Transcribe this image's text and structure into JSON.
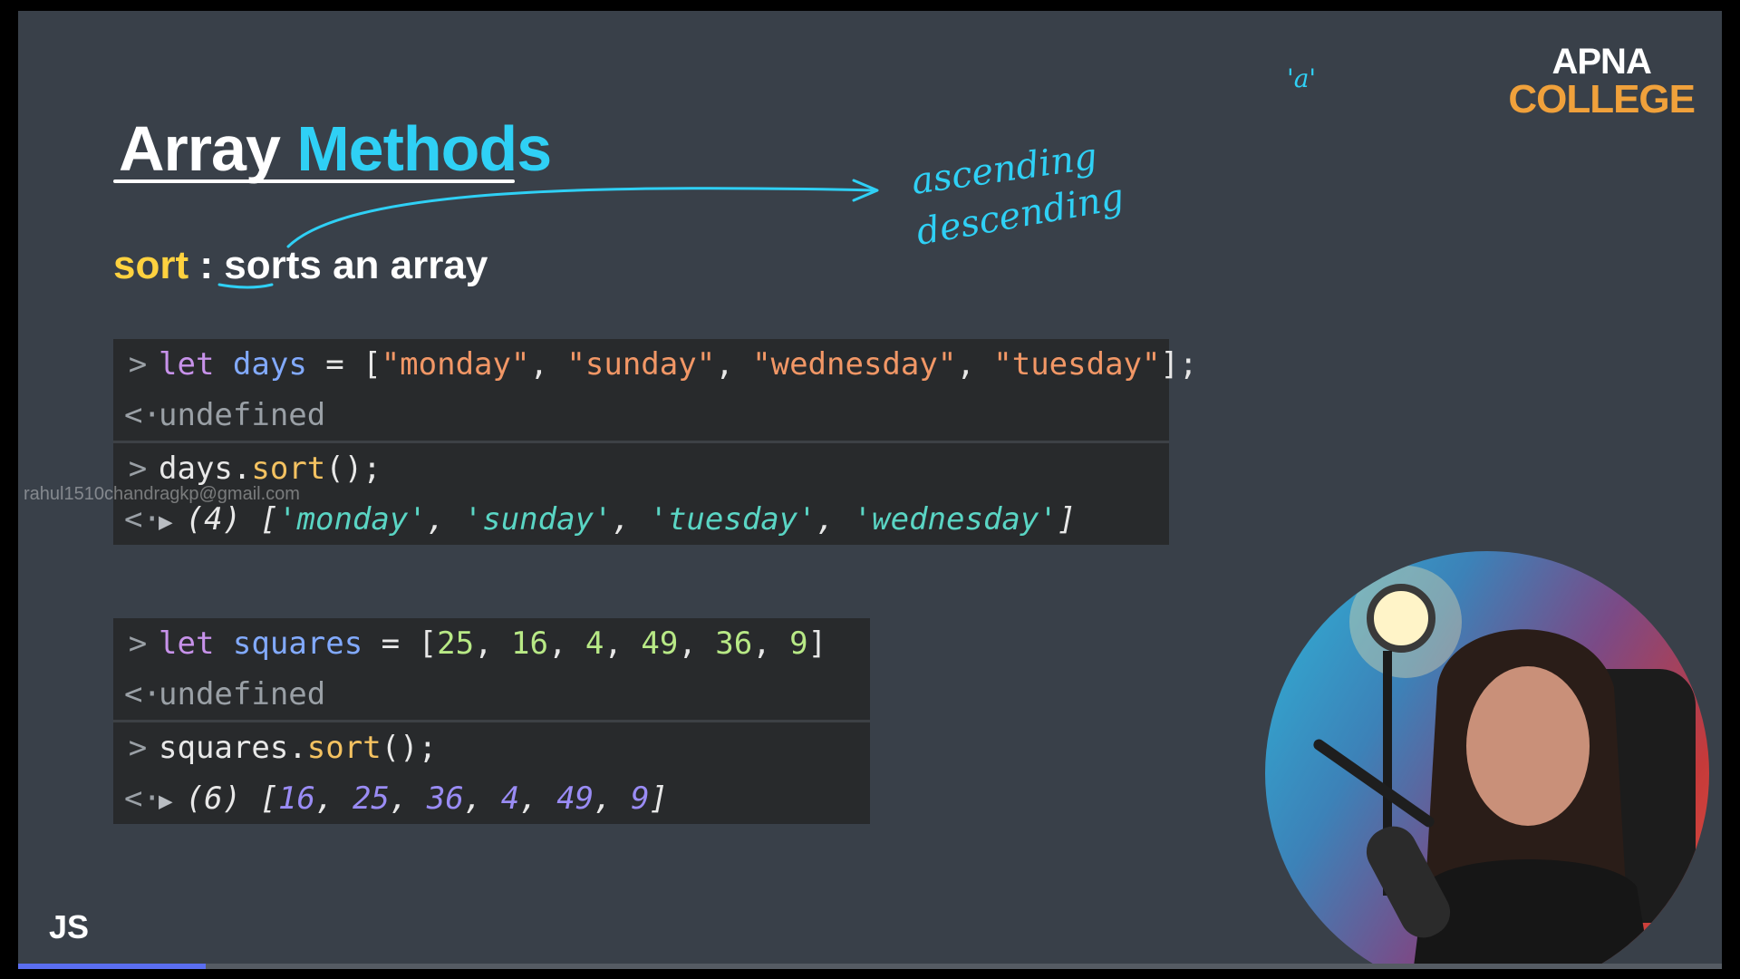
{
  "slide": {
    "title_part1": "Array",
    "title_part2": "Methods",
    "method_keyword": "sort",
    "method_separator": ":",
    "method_description": "sorts an array"
  },
  "brand": {
    "line1": "APNA",
    "line2": "COLLEGE"
  },
  "annotations": {
    "quote_a": "'a'",
    "word1": "ascending",
    "word2": "descending"
  },
  "console1": {
    "line1": {
      "prompt": ">",
      "keyword": "let",
      "variable": "days",
      "operator": " = ",
      "open": "[",
      "items": [
        "\"monday\"",
        "\"sunday\"",
        "\"wednesday\"",
        "\"tuesday\""
      ],
      "close": "];"
    },
    "line2": {
      "prompt": "<·",
      "text": "undefined"
    },
    "line3": {
      "prompt": ">",
      "object": "days",
      "dot": ".",
      "method": "sort",
      "call": "();"
    },
    "line4": {
      "prompt": "<·",
      "count": "(4)",
      "open": "[",
      "items": [
        "'monday'",
        "'sunday'",
        "'tuesday'",
        "'wednesday'"
      ],
      "close": "]"
    }
  },
  "console2": {
    "line1": {
      "prompt": ">",
      "keyword": "let",
      "variable": "squares",
      "operator": " = ",
      "open": "[",
      "items": [
        "25",
        "16",
        "4",
        "49",
        "36",
        "9"
      ],
      "close": "]"
    },
    "line2": {
      "prompt": "<·",
      "text": "undefined"
    },
    "line3": {
      "prompt": ">",
      "object": "squares",
      "dot": ".",
      "method": "sort",
      "call": "();"
    },
    "line4": {
      "prompt": "<·",
      "count": "(6)",
      "open": "[",
      "items": [
        "16",
        "25",
        "36",
        "4",
        "49",
        "9"
      ],
      "close": "]"
    }
  },
  "watermark": "rahul1510chandragkp@gmail.com",
  "footer": {
    "language_label": "JS"
  },
  "video_progress": 0.11,
  "colors": {
    "accent_cyan": "#2fd0f5",
    "keyword_yellow": "#ffd23f",
    "brand_orange": "#f0a13b",
    "slide_bg": "#394049",
    "console_bg": "#282a2c"
  }
}
